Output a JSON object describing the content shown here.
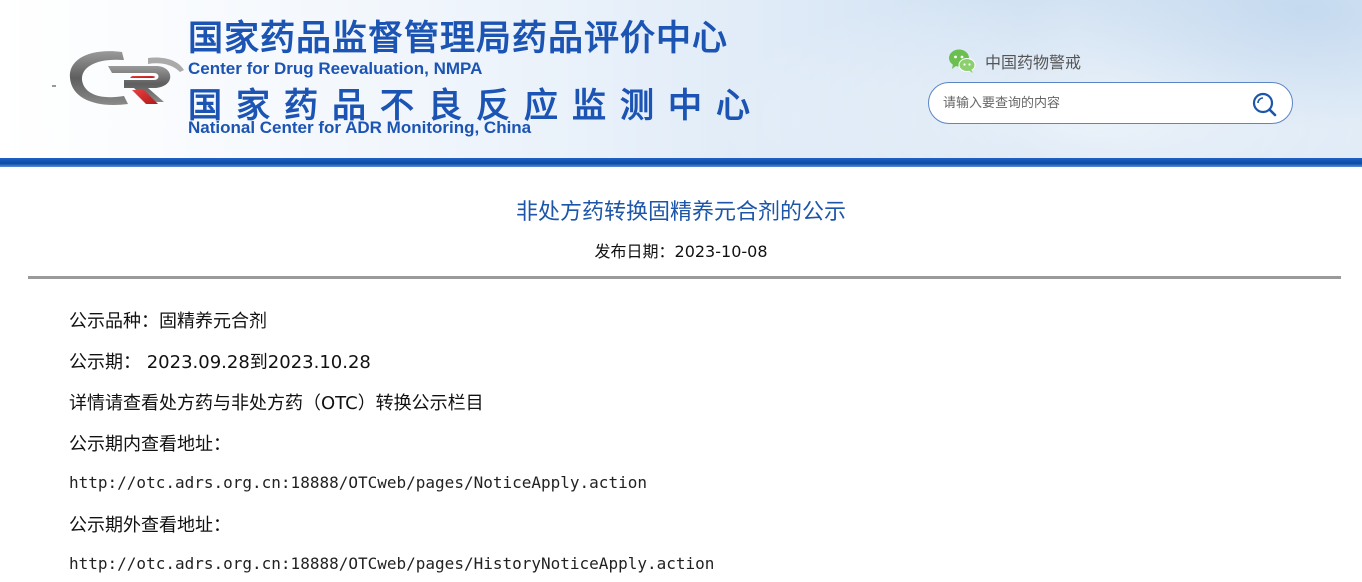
{
  "header": {
    "cn_title_1": "国家药品监督管理局药品评价中心",
    "en_title_1": "Center for Drug Reevaluation, NMPA",
    "cn_title_2": "国家药品不良反应监测中心",
    "en_title_2": "National Center for ADR Monitoring, China",
    "wechat_label": "中国药物警戒",
    "search_placeholder": "请输入要查询的内容",
    "logo_icon": "cdr-logo-icon",
    "wechat_icon": "wechat-icon",
    "search_icon": "search-icon",
    "brand_color": "#1c54b4"
  },
  "article": {
    "title": "非处方药转换固精养元合剂的公示",
    "date_label": "发布日期：",
    "date_value": "2023-10-08",
    "variety_label": "公示品种：",
    "variety_value": "固精养元合剂",
    "period_label": "公示期：",
    "period_start": "2023.09.28",
    "period_to": "到",
    "period_end": "2023.10.28",
    "detail_part1": "详情请查看处方药与非处方药（",
    "detail_otc": "OTC",
    "detail_part2": "）转换公示栏目",
    "inside_label": "公示期内查看地址：",
    "inside_url": "http://otc.adrs.org.cn:18888/OTCweb/pages/NoticeApply.action",
    "outside_label": "公示期外查看地址：",
    "outside_url": "http://otc.adrs.org.cn:18888/OTCweb/pages/HistoryNoticeApply.action"
  }
}
